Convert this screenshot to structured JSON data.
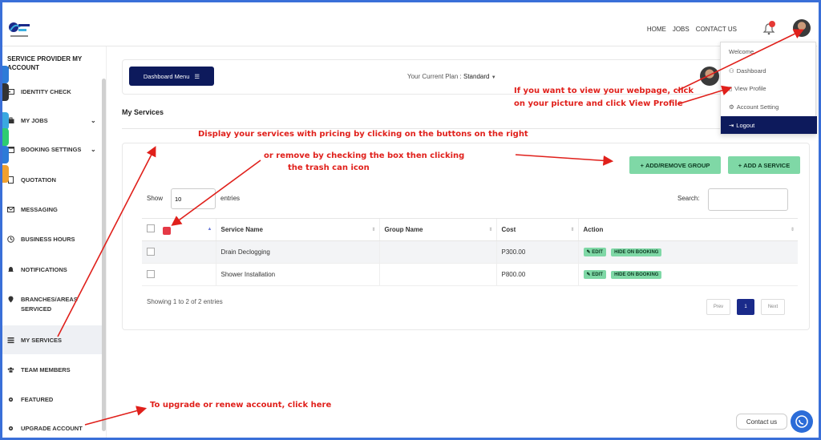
{
  "topnav": {
    "home": "HOME",
    "jobs": "JOBS",
    "contact": "CONTACT US",
    "bell_count": "0"
  },
  "sidebar": {
    "title": "SERVICE PROVIDER MY ACCOUNT",
    "items": [
      {
        "label": "IDENTITY CHECK"
      },
      {
        "label": "MY JOBS"
      },
      {
        "label": "BOOKING SETTINGS"
      },
      {
        "label": "QUOTATION"
      },
      {
        "label": "MESSAGING"
      },
      {
        "label": "BUSINESS HOURS"
      },
      {
        "label": "NOTIFICATIONS"
      },
      {
        "label": "BRANCHES/AREAS SERVICED"
      },
      {
        "label": "MY SERVICES"
      },
      {
        "label": "TEAM MEMBERS"
      },
      {
        "label": "FEATURED"
      },
      {
        "label": "UPGRADE ACCOUNT"
      }
    ]
  },
  "dashboard": {
    "menu_label": "Dashboard Menu",
    "plan_label": "Your Current Plan :",
    "plan_value": "Standard"
  },
  "main": {
    "heading": "My Services",
    "add_group": "ADD/REMOVE GROUP",
    "add_service": "ADD A SERVICE",
    "show": "Show",
    "show_value": "10",
    "entries": "entries",
    "search": "Search:",
    "columns": [
      "Service Name",
      "Group Name",
      "Cost",
      "Action"
    ],
    "rows": [
      {
        "service": "Drain Declogging",
        "group": "",
        "cost": "P300.00"
      },
      {
        "service": "Shower Installation",
        "group": "",
        "cost": "P800.00"
      }
    ],
    "edit": "EDIT",
    "hide": "HIDE ON BOOKING",
    "showing": "Showing 1 to 2 of 2 entries",
    "prev": "Prev",
    "page": "1",
    "next": "Next"
  },
  "dropdown": {
    "welcome": "Welcome,",
    "dashboard": "Dashboard",
    "view_profile": "View Profile",
    "account_setting": "Account Setting",
    "logout": "Logout"
  },
  "annotations": {
    "display": "Display your services with pricing by clicking on the buttons on the right",
    "remove_1": "or remove by checking the box then clicking",
    "remove_2": "the trash can icon",
    "webpage_1": "If you want to view your webpage, click",
    "webpage_2": "on your picture and click  View Profile",
    "upgrade": "To upgrade or renew account, click here"
  },
  "contact_label": "Contact us",
  "colors": {
    "navy": "#0d1a5c",
    "green": "#7fd8a6",
    "annotation_red": "#e0201b",
    "frame_blue": "#3a6fd8"
  }
}
